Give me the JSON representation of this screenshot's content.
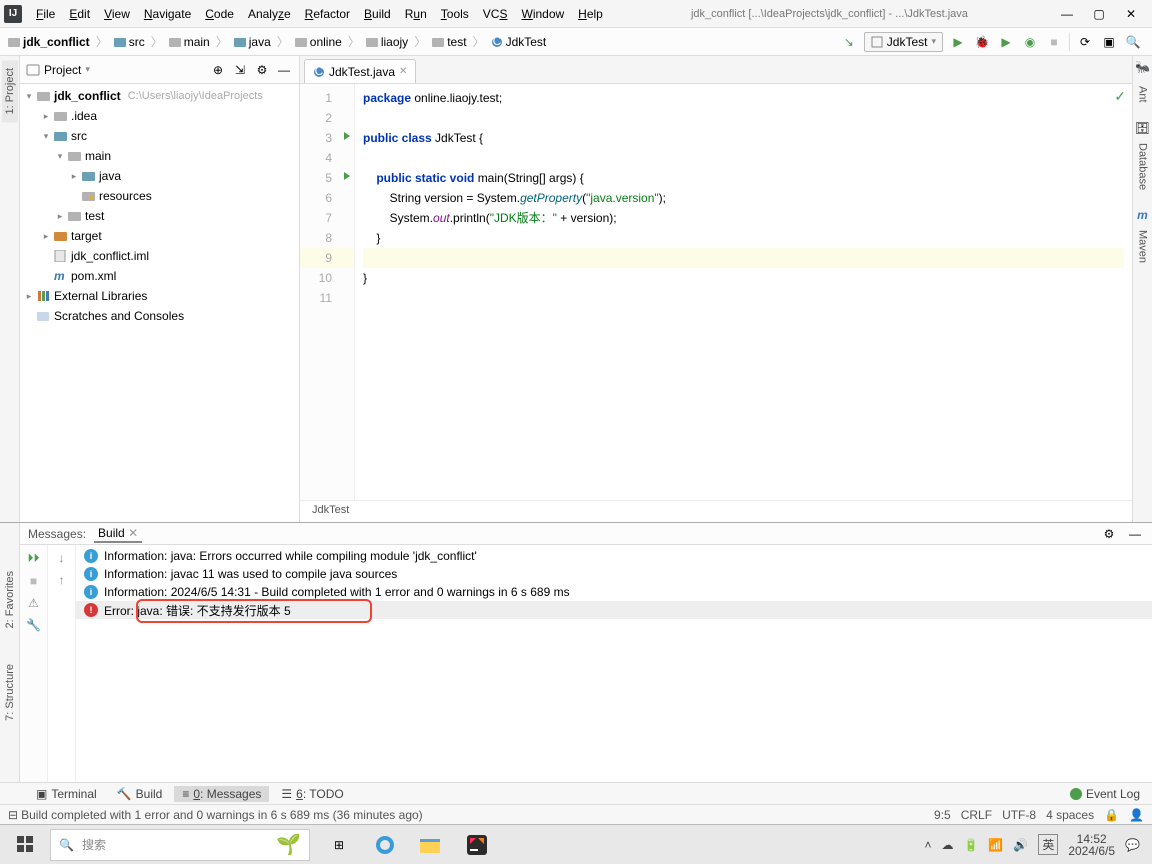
{
  "titlebar": {
    "title": "jdk_conflict [...\\IdeaProjects\\jdk_conflict] - ...\\JdkTest.java"
  },
  "menu": {
    "file": "File",
    "edit": "Edit",
    "view": "View",
    "navigate": "Navigate",
    "code": "Code",
    "analyze": "Analyze",
    "refactor": "Refactor",
    "build": "Build",
    "run": "Run",
    "tools": "Tools",
    "vcs": "VCS",
    "window": "Window",
    "help": "Help"
  },
  "breadcrumbs": {
    "b0": "jdk_conflict",
    "b1": "src",
    "b2": "main",
    "b3": "java",
    "b4": "online",
    "b5": "liaojy",
    "b6": "test",
    "b7": "JdkTest"
  },
  "runconfig": {
    "label": "JdkTest"
  },
  "project_panel": {
    "title": "Project"
  },
  "tree": {
    "root": "jdk_conflict",
    "root_meta": "C:\\Users\\liaojy\\IdeaProjects",
    "idea": ".idea",
    "src": "src",
    "main": "main",
    "java": "java",
    "resources": "resources",
    "test": "test",
    "target": "target",
    "iml": "jdk_conflict.iml",
    "pom": "pom.xml",
    "ext": "External Libraries",
    "scratch": "Scratches and Consoles"
  },
  "tab": {
    "name": "JdkTest.java"
  },
  "code": {
    "l1a": "package ",
    "l1b": "online.liaojy.test;",
    "l3a": "public class ",
    "l3b": "JdkTest {",
    "l5a": "    public static void ",
    "l5b": "main(String[] args) {",
    "l6a": "        String version = System.",
    "l6b": "getProperty",
    "l6c": "(",
    "l6d": "\"java.version\"",
    "l6e": ");",
    "l7a": "        System.",
    "l7b": "out",
    "l7c": ".println(",
    "l7d": "\"JDK版本：\"",
    "l7e": " + version);",
    "l8": "    }",
    "l10": "}"
  },
  "editor_breadcrumb": "JdkTest",
  "messages": {
    "label": "Messages:",
    "tab": "Build",
    "r1": "Information: java: Errors occurred while compiling module 'jdk_conflict'",
    "r2": "Information: javac 11 was used to compile java sources",
    "r3": "Information: 2024/6/5 14:31 - Build completed with 1 error and 0 warnings in 6 s 689 ms",
    "r4": "Error: java: 错误: 不支持发行版本 5"
  },
  "rails": {
    "left1": "1: Project",
    "right1": "Ant",
    "right2": "Database",
    "right3": "Maven",
    "fav": "2: Favorites",
    "struct": "7: Structure"
  },
  "bottom_tools": {
    "terminal": "Terminal",
    "build": "Build",
    "messages": "0: Messages",
    "todo": "6: TODO",
    "eventlog": "Event Log"
  },
  "status": {
    "text": "Build completed with 1 error and 0 warnings in 6 s 689 ms (36 minutes ago)",
    "pos": "9:5",
    "crlf": "CRLF",
    "enc": "UTF-8",
    "indent": "4 spaces"
  },
  "taskbar": {
    "search_placeholder": "搜索",
    "time": "14:52",
    "date": "2024/6/5",
    "ime": "英"
  }
}
